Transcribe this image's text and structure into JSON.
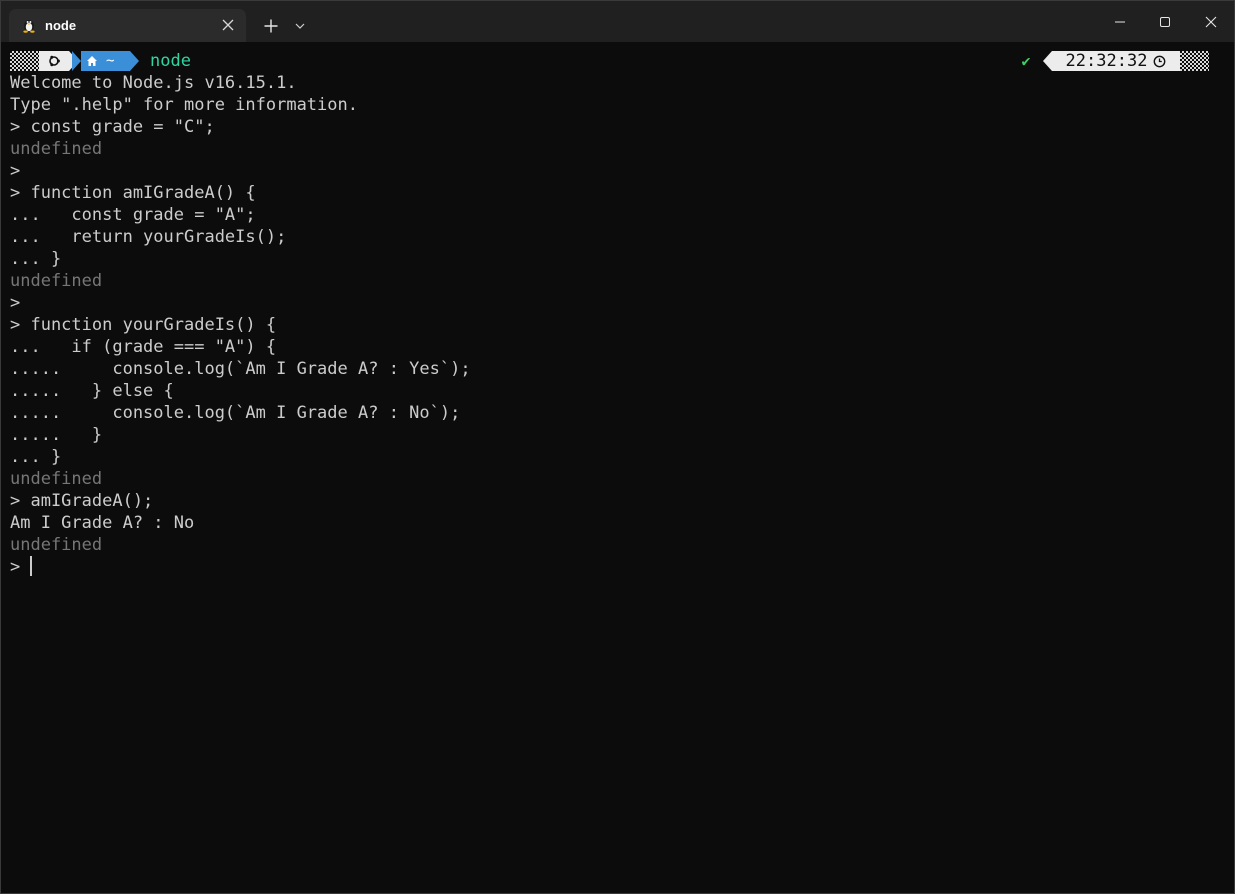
{
  "window": {
    "tab_title": "node",
    "tab_icon": "linux-penguin-icon",
    "new_tab_icon": "plus-icon",
    "dropdown_icon": "chevron-down-icon",
    "minimize_icon": "minimize-icon",
    "maximize_icon": "maximize-icon",
    "close_icon": "close-icon"
  },
  "prompt": {
    "os_icon": "ubuntu-icon",
    "home_icon": "home-icon",
    "path": "~",
    "command": "node",
    "status_icon": "check-icon",
    "status_glyph": "✔",
    "time": "22:32:32",
    "clock_icon": "clock-icon",
    "colors": {
      "command": "#2fd6a0",
      "path_segment": "#3a8fd8",
      "os_segment": "#ececec",
      "status_ok": "#3fcf66"
    }
  },
  "terminal": {
    "lines": [
      {
        "text": "Welcome to Node.js v16.15.1.",
        "dim": false
      },
      {
        "text": "Type \".help\" for more information.",
        "dim": false
      },
      {
        "text": "> const grade = \"C\";",
        "dim": false
      },
      {
        "text": "undefined",
        "dim": true
      },
      {
        "text": ">",
        "dim": false
      },
      {
        "text": "> function amIGradeA() {",
        "dim": false
      },
      {
        "text": "...   const grade = \"A\";",
        "dim": false
      },
      {
        "text": "...   return yourGradeIs();",
        "dim": false
      },
      {
        "text": "... }",
        "dim": false
      },
      {
        "text": "undefined",
        "dim": true
      },
      {
        "text": ">",
        "dim": false
      },
      {
        "text": "> function yourGradeIs() {",
        "dim": false
      },
      {
        "text": "...   if (grade === \"A\") {",
        "dim": false
      },
      {
        "text": ".....     console.log(`Am I Grade A? : Yes`);",
        "dim": false
      },
      {
        "text": ".....   } else {",
        "dim": false
      },
      {
        "text": ".....     console.log(`Am I Grade A? : No`);",
        "dim": false
      },
      {
        "text": ".....   }",
        "dim": false
      },
      {
        "text": "... }",
        "dim": false
      },
      {
        "text": "undefined",
        "dim": true
      },
      {
        "text": "> amIGradeA();",
        "dim": false
      },
      {
        "text": "Am I Grade A? : No",
        "dim": false
      },
      {
        "text": "undefined",
        "dim": true
      }
    ],
    "current_prompt": "> "
  }
}
